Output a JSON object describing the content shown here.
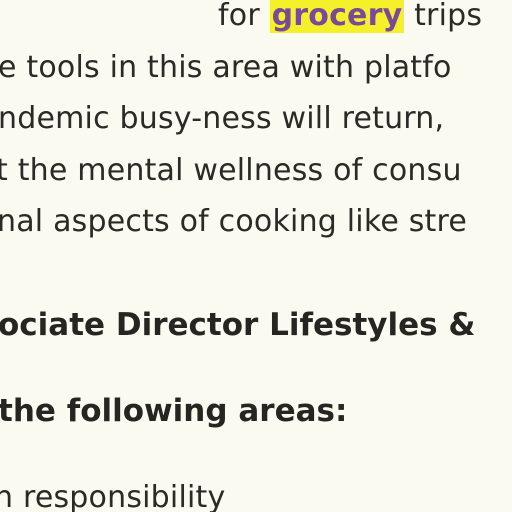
{
  "article": {
    "line1_before": "for ",
    "line1_highlight": "grocery",
    "line1_after": " trips",
    "line2": "e tools in this area with platfo",
    "line3": "ndemic busy-ness will return,",
    "line4": "t the mental wellness of consu",
    "line5": "nal aspects of cooking like stre",
    "heading1": "ociate Director Lifestyles &",
    "heading2": "the following areas:",
    "line6": "n responsibility"
  },
  "colors": {
    "background": "#fbfaf1",
    "text": "#2b2a26",
    "highlight_bg": "#f6f02a",
    "highlight_text": "#7a4a9a"
  }
}
